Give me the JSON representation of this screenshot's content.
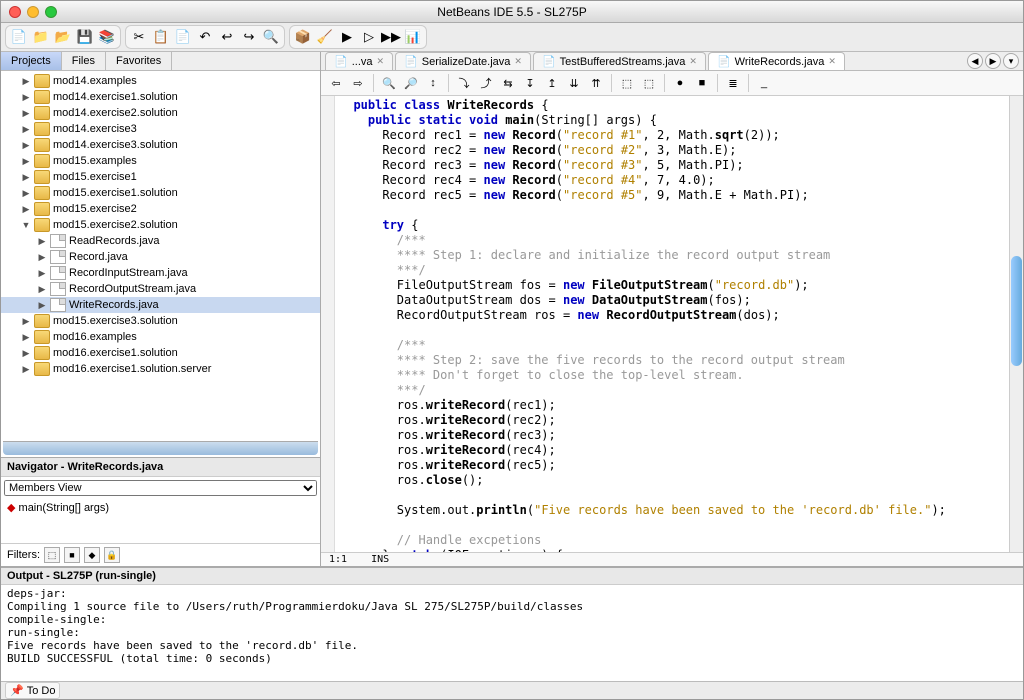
{
  "title": "NetBeans IDE 5.5 - SL275P",
  "toolbar_main": {
    "groups": [
      [
        "new-file-icon",
        "new-project-icon",
        "open-icon",
        "save-icon",
        "save-all-icon"
      ],
      [
        "cut-icon",
        "copy-icon",
        "paste-icon",
        "back-icon",
        "undo-icon",
        "redo-icon",
        "find-icon"
      ],
      [
        "build-icon",
        "clean-build-icon",
        "run-icon",
        "debug-icon",
        "run-main-icon",
        "profile-icon"
      ]
    ],
    "glyphs": {
      "new-file-icon": "📄",
      "new-project-icon": "📁",
      "open-icon": "📂",
      "save-icon": "💾",
      "save-all-icon": "📚",
      "cut-icon": "✂",
      "copy-icon": "📋",
      "paste-icon": "📄",
      "back-icon": "↶",
      "undo-icon": "↩",
      "redo-icon": "↪",
      "find-icon": "🔍",
      "build-icon": "📦",
      "clean-build-icon": "🧹",
      "run-icon": "▶",
      "debug-icon": "▷",
      "run-main-icon": "▶▶",
      "profile-icon": "📊"
    }
  },
  "proj_tabs": [
    "Projects",
    "Files",
    "Favorites"
  ],
  "proj_tabs_active": 0,
  "tree": [
    {
      "t": "mod14.examples",
      "k": "pkg",
      "d": 1,
      "a": "▶"
    },
    {
      "t": "mod14.exercise1.solution",
      "k": "pkg",
      "d": 1,
      "a": "▶"
    },
    {
      "t": "mod14.exercise2.solution",
      "k": "pkg",
      "d": 1,
      "a": "▶"
    },
    {
      "t": "mod14.exercise3",
      "k": "pkg",
      "d": 1,
      "a": "▶"
    },
    {
      "t": "mod14.exercise3.solution",
      "k": "pkg",
      "d": 1,
      "a": "▶"
    },
    {
      "t": "mod15.examples",
      "k": "pkg",
      "d": 1,
      "a": "▶"
    },
    {
      "t": "mod15.exercise1",
      "k": "pkg",
      "d": 1,
      "a": "▶"
    },
    {
      "t": "mod15.exercise1.solution",
      "k": "pkg",
      "d": 1,
      "a": "▶"
    },
    {
      "t": "mod15.exercise2",
      "k": "pkg",
      "d": 1,
      "a": "▶"
    },
    {
      "t": "mod15.exercise2.solution",
      "k": "pkg",
      "d": 1,
      "a": "▼"
    },
    {
      "t": "ReadRecords.java",
      "k": "java",
      "d": 2,
      "a": "▶"
    },
    {
      "t": "Record.java",
      "k": "java",
      "d": 2,
      "a": "▶"
    },
    {
      "t": "RecordInputStream.java",
      "k": "java",
      "d": 2,
      "a": "▶"
    },
    {
      "t": "RecordOutputStream.java",
      "k": "java",
      "d": 2,
      "a": "▶"
    },
    {
      "t": "WriteRecords.java",
      "k": "java",
      "d": 2,
      "a": "▶",
      "sel": true
    },
    {
      "t": "mod15.exercise3.solution",
      "k": "pkg",
      "d": 1,
      "a": "▶"
    },
    {
      "t": "mod16.examples",
      "k": "pkg",
      "d": 1,
      "a": "▶"
    },
    {
      "t": "mod16.exercise1.solution",
      "k": "pkg",
      "d": 1,
      "a": "▶"
    },
    {
      "t": "mod16.exercise1.solution.server",
      "k": "pkg",
      "d": 1,
      "a": "▶"
    }
  ],
  "navigator": {
    "title": "Navigator - WriteRecords.java",
    "view": "Members View",
    "member": "main(String[] args)",
    "filters_label": "Filters:"
  },
  "editor_tabs": [
    {
      "label": "...va"
    },
    {
      "label": "SerializeDate.java"
    },
    {
      "label": "TestBufferedStreams.java"
    },
    {
      "label": "WriteRecords.java",
      "active": true
    }
  ],
  "editor_toolbar": [
    "⇦",
    "⇨",
    "|",
    "🔍",
    "🔎",
    "↕",
    "|",
    "⤵",
    "⤴",
    "⇆",
    "↧",
    "↥",
    "⇊",
    "⇈",
    "|",
    "⬚",
    "⬚",
    "|",
    "●",
    "■",
    "|",
    "≣",
    "|",
    "_"
  ],
  "status": {
    "pos": "1:1",
    "mode": "INS"
  },
  "code_html": "  <span class='kw'>public class</span> <span class='cls'>WriteRecords</span> {\n    <span class='kw'>public static void</span> <span class='cls'>main</span>(String[] args) {\n      Record rec1 = <span class='kw'>new</span> <span class='cls'>Record</span>(<span class='str'>\"record #1\"</span>, 2, Math.<span class='cls'>sqrt</span>(2));\n      Record rec2 = <span class='kw'>new</span> <span class='cls'>Record</span>(<span class='str'>\"record #2\"</span>, 3, Math.E);\n      Record rec3 = <span class='kw'>new</span> <span class='cls'>Record</span>(<span class='str'>\"record #3\"</span>, 5, Math.PI);\n      Record rec4 = <span class='kw'>new</span> <span class='cls'>Record</span>(<span class='str'>\"record #4\"</span>, 7, 4.0);\n      Record rec5 = <span class='kw'>new</span> <span class='cls'>Record</span>(<span class='str'>\"record #5\"</span>, 9, Math.E + Math.PI);\n\n      <span class='kw'>try</span> {\n        <span class='cm'>/***</span>\n        <span class='cm'>**** Step 1: declare and initialize the record output stream</span>\n        <span class='cm'>***/</span>\n        FileOutputStream fos = <span class='kw'>new</span> <span class='cls'>FileOutputStream</span>(<span class='str'>\"record.db\"</span>);\n        DataOutputStream dos = <span class='kw'>new</span> <span class='cls'>DataOutputStream</span>(fos);\n        RecordOutputStream ros = <span class='kw'>new</span> <span class='cls'>RecordOutputStream</span>(dos);\n\n        <span class='cm'>/***</span>\n        <span class='cm'>**** Step 2: save the five records to the record output stream</span>\n        <span class='cm'>**** Don't forget to close the top-level stream.</span>\n        <span class='cm'>***/</span>\n        ros.<span class='cls'>writeRecord</span>(rec1);\n        ros.<span class='cls'>writeRecord</span>(rec2);\n        ros.<span class='cls'>writeRecord</span>(rec3);\n        ros.<span class='cls'>writeRecord</span>(rec4);\n        ros.<span class='cls'>writeRecord</span>(rec5);\n        ros.<span class='cls'>close</span>();\n\n        System.out.<span class='cls'>println</span>(<span class='str'>\"Five records have been saved to the 'record.db' file.\"</span>);\n\n        <span class='cm'>// Handle excpetions</span>\n      } <span class='kw'>catch</span> (IOException e) {",
  "output": {
    "title": "Output - SL275P (run-single)",
    "text": "deps-jar:\nCompiling 1 source file to /Users/ruth/Programmierdoku/Java SL 275/SL275P/build/classes\ncompile-single:\nrun-single:\nFive records have been saved to the 'record.db' file.\nBUILD SUCCESSFUL (total time: 0 seconds)"
  },
  "footer": {
    "todo": "To Do"
  }
}
